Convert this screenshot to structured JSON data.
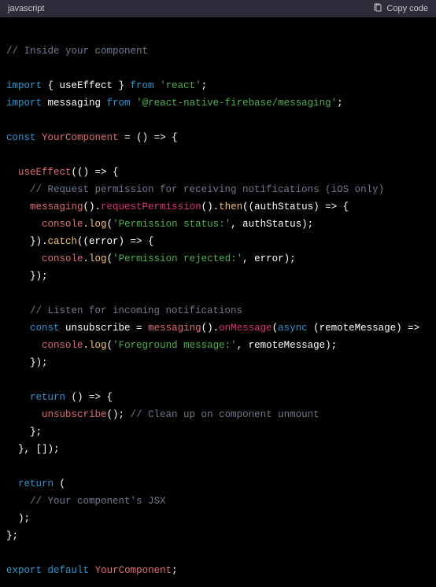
{
  "header": {
    "language": "javascript",
    "copy_label": "Copy code"
  },
  "code": {
    "c1": "// Inside your component",
    "l_import1a": "import",
    "l_import1b": " { useEffect } ",
    "l_import1c": "from",
    "l_import1d": " ",
    "l_import1e": "'react'",
    "l_import1f": ";",
    "l_import2a": "import",
    "l_import2b": " messaging ",
    "l_import2c": "from",
    "l_import2d": " ",
    "l_import2e": "'@react-native-firebase/messaging'",
    "l_import2f": ";",
    "l_const1a": "const",
    "l_const1b": " ",
    "l_const1c": "YourComponent",
    "l_const1d": " = () => {",
    "l_ue1a": "  ",
    "l_ue1b": "useEffect",
    "l_ue1c": "(() => {",
    "c2": "    // Request permission for receiving notifications (iOS only)",
    "l_msg1a": "    ",
    "l_msg1b": "messaging",
    "l_msg1c": "().",
    "l_msg1d": "requestPermission",
    "l_msg1e": "().",
    "l_msg1f": "then",
    "l_msg1g": "((authStatus) => {",
    "l_log1a": "      ",
    "l_log1b": "console",
    "l_log1c": ".",
    "l_log1d": "log",
    "l_log1e": "(",
    "l_log1f": "'Permission status:'",
    "l_log1g": ", authStatus);",
    "l_catch1a": "    }).",
    "l_catch1b": "catch",
    "l_catch1c": "((error) => {",
    "l_log2a": "      ",
    "l_log2b": "console",
    "l_log2c": ".",
    "l_log2d": "log",
    "l_log2e": "(",
    "l_log2f": "'Permission rejected:'",
    "l_log2g": ", error);",
    "l_close1": "    });",
    "c3": "    // Listen for incoming notifications",
    "l_unsub1a": "    ",
    "l_unsub1b": "const",
    "l_unsub1c": " unsubscribe = ",
    "l_unsub1d": "messaging",
    "l_unsub1e": "().",
    "l_unsub1f": "onMessage",
    "l_unsub1g": "(",
    "l_unsub1h": "async",
    "l_unsub1i": " (remoteMessage) =>",
    "l_log3a": "      ",
    "l_log3b": "console",
    "l_log3c": ".",
    "l_log3d": "log",
    "l_log3e": "(",
    "l_log3f": "'Foreground message:'",
    "l_log3g": ", remoteMessage);",
    "l_close2": "    });",
    "l_ret1a": "    ",
    "l_ret1b": "return",
    "l_ret1c": " () => {",
    "l_unsub2a": "      ",
    "l_unsub2b": "unsubscribe",
    "l_unsub2c": "(); ",
    "l_unsub2d": "// Clean up on component unmount",
    "l_close3": "    };",
    "l_close4": "  }, []);",
    "l_ret2a": "  ",
    "l_ret2b": "return",
    "l_ret2c": " (",
    "c4": "    // Your component's JSX",
    "l_close5": "  );",
    "l_close6": "};",
    "l_exp1a": "export",
    "l_exp1b": " ",
    "l_exp1c": "default",
    "l_exp1d": " ",
    "l_exp1e": "YourComponent",
    "l_exp1f": ";"
  }
}
